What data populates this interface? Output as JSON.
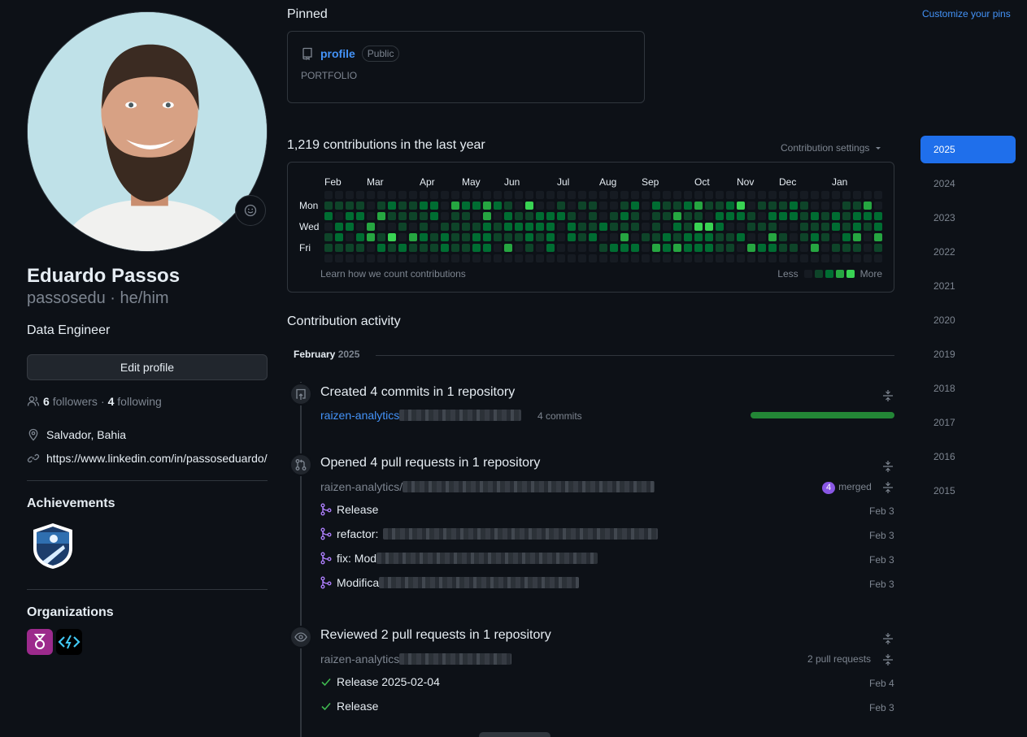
{
  "profile": {
    "full_name": "Eduardo Passos",
    "login_line": "passosedu · he/him",
    "bio": "Data Engineer",
    "edit_label": "Edit profile",
    "followers_count": "6",
    "followers_label": "followers",
    "following_count": "4",
    "following_label": "following",
    "location": "Salvador, Bahia",
    "link": "https://www.linkedin.com/in/passoseduardo/",
    "achievements_heading": "Achievements",
    "organizations_heading": "Organizations"
  },
  "pinned": {
    "heading": "Pinned",
    "customize_label": "Customize your pins",
    "repo_name": "profile",
    "visibility": "Public",
    "description": "PORTFOLIO"
  },
  "contributions": {
    "heading": "1,219 contributions in the last year",
    "settings_label": "Contribution settings",
    "months": [
      "Feb",
      "Mar",
      "Apr",
      "May",
      "Jun",
      "Jul",
      "Aug",
      "Sep",
      "Oct",
      "Nov",
      "Dec",
      "Jan"
    ],
    "day_labels": [
      "Mon",
      "Wed",
      "Fri"
    ],
    "learn_label": "Learn how we count contributions",
    "less_label": "Less",
    "more_label": "More",
    "level_colors": [
      "#161b22",
      "#0e4429",
      "#006d32",
      "#26a641",
      "#39d353"
    ]
  },
  "activity": {
    "heading": "Contribution activity",
    "month": "February",
    "year": "2025",
    "commits": {
      "title": "Created 4 commits in 1 repository",
      "repo": "raizen-analytics",
      "count_label": "4 commits",
      "progress": 1.0
    },
    "pulls": {
      "title": "Opened 4 pull requests in 1 repository",
      "repo": "raizen-analytics/",
      "merged_count": "4",
      "merged_label": "merged",
      "items": [
        {
          "title": "Release",
          "date": "Feb 3"
        },
        {
          "title": "refactor:",
          "date": "Feb 3"
        },
        {
          "title": "fix: Mod",
          "date": "Feb 3"
        },
        {
          "title": "Modifica",
          "date": "Feb 3"
        }
      ]
    },
    "reviews": {
      "title": "Reviewed 2 pull requests in 1 repository",
      "repo": "raizen-analytics",
      "count_label": "2 pull requests",
      "items": [
        {
          "title": "Release 2025-02-04",
          "date": "Feb 4"
        },
        {
          "title": "Release",
          "date": "Feb 3"
        }
      ]
    }
  },
  "years": [
    "2025",
    "2024",
    "2023",
    "2022",
    "2021",
    "2020",
    "2019",
    "2018",
    "2017",
    "2016",
    "2015"
  ],
  "selected_year": "2025"
}
